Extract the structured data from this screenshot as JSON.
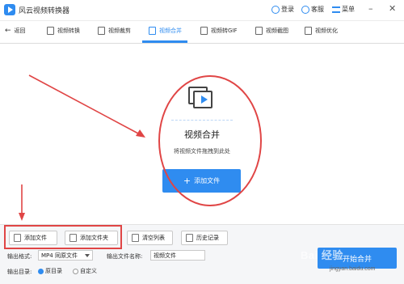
{
  "app": {
    "title": "风云视频转换器",
    "login": "登录",
    "service": "客服",
    "menu": "菜单",
    "minimize": "–",
    "close": "✕"
  },
  "nav": {
    "back": "返回",
    "tabs": [
      {
        "label": "视频转换"
      },
      {
        "label": "视频裁剪"
      },
      {
        "label": "视频合并"
      },
      {
        "label": "视频转GIF"
      },
      {
        "label": "视频截图"
      },
      {
        "label": "视频优化"
      }
    ],
    "active_tab": "视频合并"
  },
  "drop_zone": {
    "title": "视频合并",
    "hint": "将视频文件拖拽到此处",
    "add_button": "添加文件",
    "add_button_icon": "plus-icon"
  },
  "toolbar": {
    "buttons": [
      {
        "label": "添加文件",
        "icon": "add-file-icon"
      },
      {
        "label": "添加文件夹",
        "icon": "add-folder-icon"
      },
      {
        "label": "清空列表",
        "icon": "trash-icon"
      },
      {
        "label": "历史记录",
        "icon": "history-icon"
      }
    ],
    "output_format_label": "输出格式:",
    "output_format_value": "MP4 同原文件",
    "output_name_label": "输出文件名称:",
    "output_name_value": "视频文件",
    "output_dir_label": "输出目录:",
    "output_dir_options": [
      "原目录",
      "自定义"
    ],
    "output_dir_selected": "原目录",
    "merge_button": "开始合并"
  },
  "watermark": {
    "text": "Bai 经验",
    "sub": "jingyan.baidu.com"
  },
  "colors": {
    "accent": "#2f8cf0",
    "annotation": "#e04545",
    "toolbar_bg": "#f5f6f8"
  }
}
